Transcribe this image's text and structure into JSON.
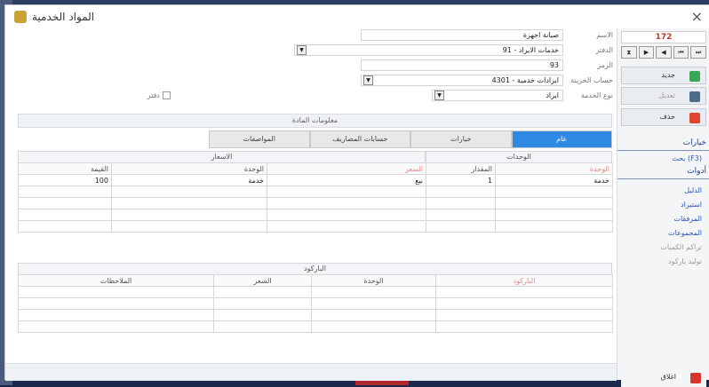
{
  "window": {
    "title": "المواد الخدمية"
  },
  "side": {
    "record_number": "172",
    "nav": [
      "⏮",
      "◀",
      "▶",
      "⏭",
      "⧗"
    ],
    "buttons": {
      "new": "جديد",
      "edit": "تعديل",
      "delete": "حذف"
    },
    "section_options": "خيارات",
    "search_label": "بحث (F3)",
    "section_tools": "أدوات",
    "tools": [
      "الدليل",
      "استيراد",
      "المرفقات",
      "المجموعات",
      "تراكم الكميات",
      "توليد باركود"
    ],
    "close_label": "اغلاق",
    "colors": {
      "new": "#3aa757",
      "edit": "#4a6b8a",
      "delete": "#e0452f",
      "close": "#d9342b"
    }
  },
  "form": {
    "name_label": "الاسم",
    "name_value": "صيانة اجهزة",
    "ledger_label": "الدفتر",
    "ledger_value": "91 - خدمات الايراد",
    "code_label": "الرمز",
    "code_value": "93",
    "account_label": "حساب الخزينة",
    "account_value": "4301 - ايرادات خدمية",
    "service_type_label": "نوع الخدمة",
    "service_type_value": "ايراد",
    "checkbox_label": "دفتر"
  },
  "material_info": "معلومات المادة",
  "tabs": [
    "عام",
    "خيارات",
    "حسابات المصاريف",
    "المواصفات"
  ],
  "units": {
    "title": "الوحدات",
    "headers": [
      "الوحدة",
      "المقدار"
    ],
    "rows": [
      [
        "خدمة",
        "1"
      ],
      [
        "",
        ""
      ],
      [
        "",
        ""
      ],
      [
        "",
        ""
      ],
      [
        "",
        ""
      ]
    ]
  },
  "prices": {
    "title": "الاسعار",
    "headers": [
      "السعر",
      "الوحدة",
      "القيمة"
    ],
    "rows": [
      [
        "بيع",
        "خدمة",
        "100"
      ],
      [
        "",
        "",
        ""
      ],
      [
        "",
        "",
        ""
      ],
      [
        "",
        "",
        ""
      ],
      [
        "",
        "",
        ""
      ]
    ]
  },
  "barcode": {
    "title": "الباركود",
    "headers": [
      "الباركود",
      "الوحدة",
      "السعر",
      "الملاحظات"
    ],
    "rows": [
      [
        "",
        "",
        "",
        ""
      ],
      [
        "",
        "",
        "",
        ""
      ],
      [
        "",
        "",
        "",
        ""
      ],
      [
        "",
        "",
        "",
        ""
      ]
    ]
  }
}
